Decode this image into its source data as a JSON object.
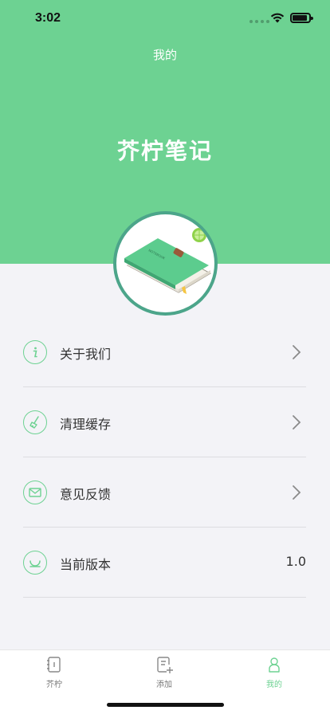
{
  "status_bar": {
    "time": "3:02"
  },
  "header": {
    "nav_title": "我的",
    "app_name": "芥柠笔记"
  },
  "colors": {
    "brand": "#6dd292",
    "avatar_border": "#4ca58a",
    "background": "#f3f3f7"
  },
  "menu": {
    "items": [
      {
        "icon": "info-icon",
        "label": "关于我们",
        "chevron": true
      },
      {
        "icon": "broom-icon",
        "label": "清理缓存",
        "chevron": true
      },
      {
        "icon": "mail-icon",
        "label": "意见反馈",
        "chevron": true
      },
      {
        "icon": "version-icon",
        "label": "当前版本",
        "value": "1.0"
      }
    ]
  },
  "tabbar": {
    "tabs": [
      {
        "icon": "notebook-icon",
        "label": "芥柠"
      },
      {
        "icon": "add-note-icon",
        "label": "添加"
      },
      {
        "icon": "person-icon",
        "label": "我的",
        "active": true
      }
    ]
  }
}
